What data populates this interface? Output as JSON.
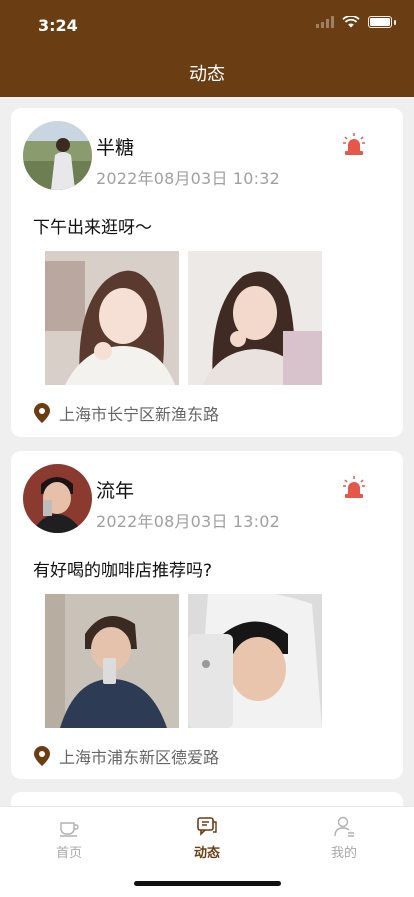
{
  "status_bar": {
    "time": "3:24"
  },
  "header": {
    "title": "动态"
  },
  "posts": [
    {
      "name": "半糖",
      "time": "2022年08月03日  10:32",
      "content": "下午出来逛呀～",
      "location": "上海市长宁区新渔东路"
    },
    {
      "name": "流年",
      "time": "2022年08月03日  13:02",
      "content": "有好喝的咖啡店推荐吗?",
      "location": "上海市浦东新区德爱路"
    }
  ],
  "tabbar": {
    "items": [
      {
        "label": "首页",
        "icon": "coffee-cup-icon"
      },
      {
        "label": "动态",
        "icon": "chat-feed-icon"
      },
      {
        "label": "我的",
        "icon": "user-icon"
      }
    ]
  },
  "colors": {
    "brand": "#6b3d12",
    "alert": "#e5564b"
  }
}
